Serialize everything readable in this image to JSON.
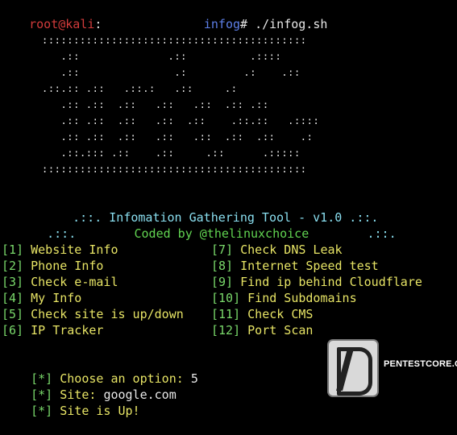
{
  "command": {
    "user": "root@kali",
    "path_sep": ":",
    "cwd": "infog",
    "prompt_symbol": "#",
    "input": "./infog.sh"
  },
  "banner": {
    "lines": [
      "::::::::::::::::::::::::::::::::::::::::::",
      "   .::              .::          .::::    ",
      "   .::               .:         .:    .:: ",
      ".::.:: .::   .::.:   .::     .:        ",
      "   .:: .::  .::   .::   .::  .:: .::     ",
      "   .:: .::  .::   .::  .::    .::.::   .::::",
      "   .:: .::  .::   .::   .::  .::  .::    .:",
      "   .::.::: .::    .::     .::      .:::::",
      "::::::::::::::::::::::::::::::::::::::::::"
    ],
    "title": ".::. Infomation Gathering Tool - v1.0 .::.",
    "coded_prefix": ".::.",
    "coded_by": "Coded by @thelinuxchoice",
    "coded_suffix": ".::."
  },
  "menu": {
    "left": [
      {
        "num": "[1]",
        "label": "Website Info"
      },
      {
        "num": "[2]",
        "label": "Phone Info"
      },
      {
        "num": "[3]",
        "label": "Check e-mail"
      },
      {
        "num": "[4]",
        "label": "My Info"
      },
      {
        "num": "[5]",
        "label": "Check site is up/down"
      },
      {
        "num": "[6]",
        "label": "IP Tracker"
      }
    ],
    "right": [
      {
        "num": "[7]",
        "label": "Check DNS Leak"
      },
      {
        "num": "[8]",
        "label": "Internet Speed test"
      },
      {
        "num": "[9]",
        "label": "Find ip behind Cloudflare"
      },
      {
        "num": "[10]",
        "label": "Find Subdomains"
      },
      {
        "num": "[11]",
        "label": "Check CMS"
      },
      {
        "num": "[12]",
        "label": "Port Scan"
      }
    ]
  },
  "session": {
    "choose_marker": "[*]",
    "choose_label": "Choose an option:",
    "choose_value": "5",
    "site_marker": "[*]",
    "site_label": "Site:",
    "site_value": "google.com",
    "result_marker": "[*]",
    "result_label": "Site is Up!"
  },
  "watermark": {
    "text": "PENTESTCORE.COM"
  }
}
